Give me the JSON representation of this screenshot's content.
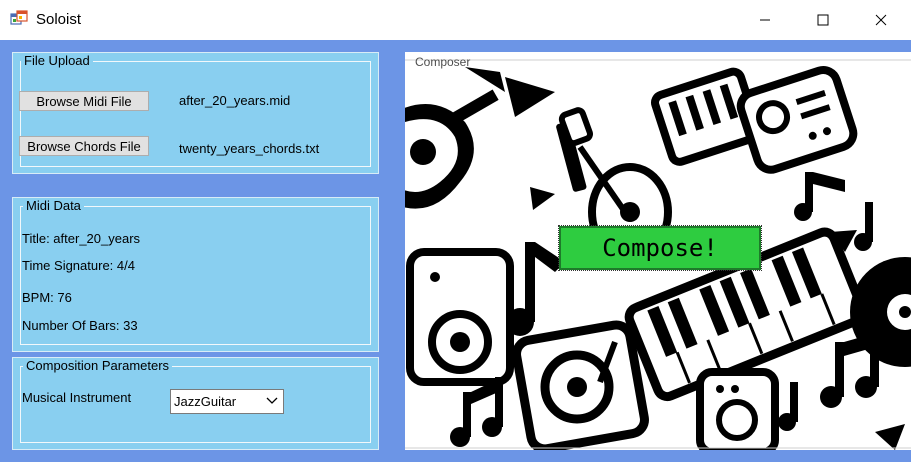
{
  "window": {
    "title": "Soloist",
    "controls": {
      "minimize": "—",
      "maximize": "☐",
      "close": "✕"
    },
    "app_icon": "app-window-icon"
  },
  "file_upload": {
    "title": "File Upload",
    "browse_midi_label": "Browse Midi File",
    "midi_file_name": "after_20_years.mid",
    "browse_chords_label": "Browse Chords File",
    "chords_file_name": "twenty_years_chords.txt"
  },
  "midi_data": {
    "title": "Midi Data",
    "title_line": "Title: after_20_years",
    "time_signature_line": "Time Signature: 4/4",
    "bpm_line": "BPM: 76",
    "bars_line": "Number Of Bars: 33"
  },
  "composition": {
    "title": "Composition Parameters",
    "instrument_label": "Musical Instrument",
    "instrument_value": "JazzGuitar"
  },
  "composer": {
    "title": "Composer",
    "compose_label": "Compose!",
    "background": "music-instruments-pattern"
  },
  "colors": {
    "client_bg": "#6c95e6",
    "group_bg": "#89cff0",
    "compose_bg": "#2ecc40"
  }
}
